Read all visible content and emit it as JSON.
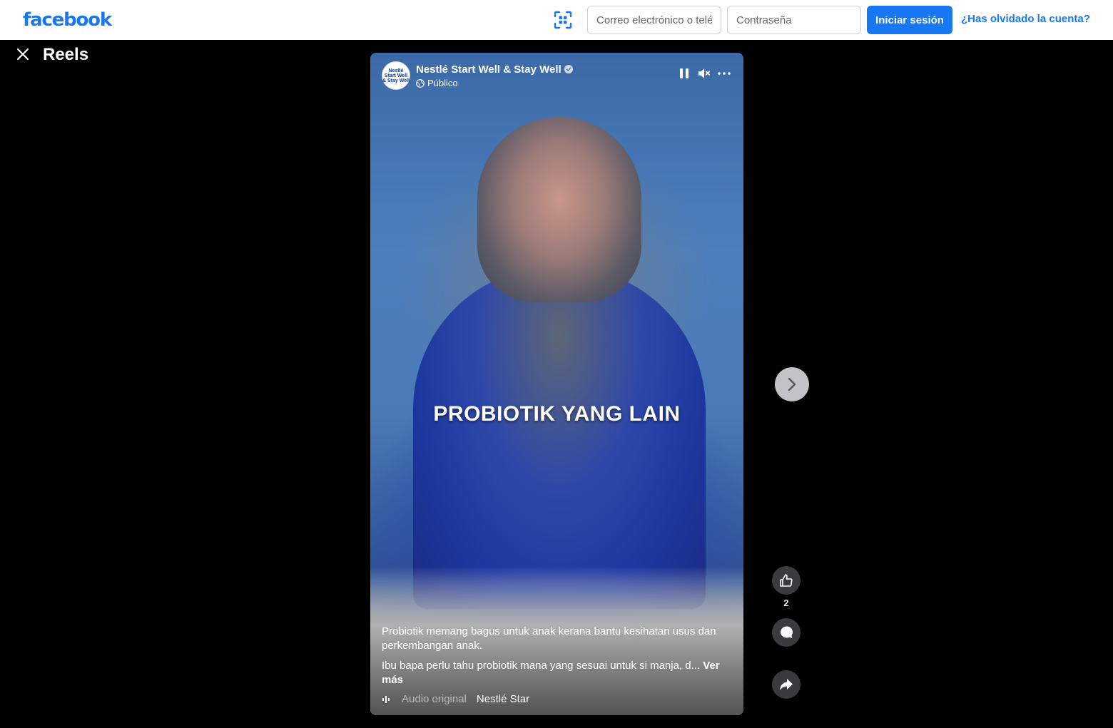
{
  "header": {
    "logo": "facebook",
    "email_placeholder": "Correo electrónico o teléfono",
    "password_placeholder": "Contraseña",
    "login_label": "Iniciar sesión",
    "forgot_label": "¿Has olvidado la cuenta?"
  },
  "reels": {
    "title": "Reels"
  },
  "video": {
    "page_avatar_text": "Nestlé Start Well & Stay Well",
    "page_name": "Nestlé Start Well & Stay Well",
    "privacy": "Público",
    "overlay_text": "PROBIOTIK YANG LAIN",
    "caption_line1": "Probiotik memang bagus untuk anak kerana bantu kesihatan usus dan perkembangan anak.",
    "caption_line2": "Ibu bapa perlu tahu probiotik mana yang sesuai untuk si manja, d...",
    "see_more": "Ver más",
    "audio_label": "Audio original",
    "audio_owner": "Nestlé Star"
  },
  "actions": {
    "like_count": "2"
  },
  "icons": [
    "scan-icon",
    "close-icon",
    "verified-icon",
    "globe-icon",
    "pause-icon",
    "mute-icon",
    "more-icon",
    "chevron-right-icon",
    "like-icon",
    "comment-icon",
    "share-icon",
    "audio-wave-icon"
  ],
  "colors": {
    "brand": "#1877f2",
    "background": "#000000",
    "action_button": "#3a3b3c"
  }
}
